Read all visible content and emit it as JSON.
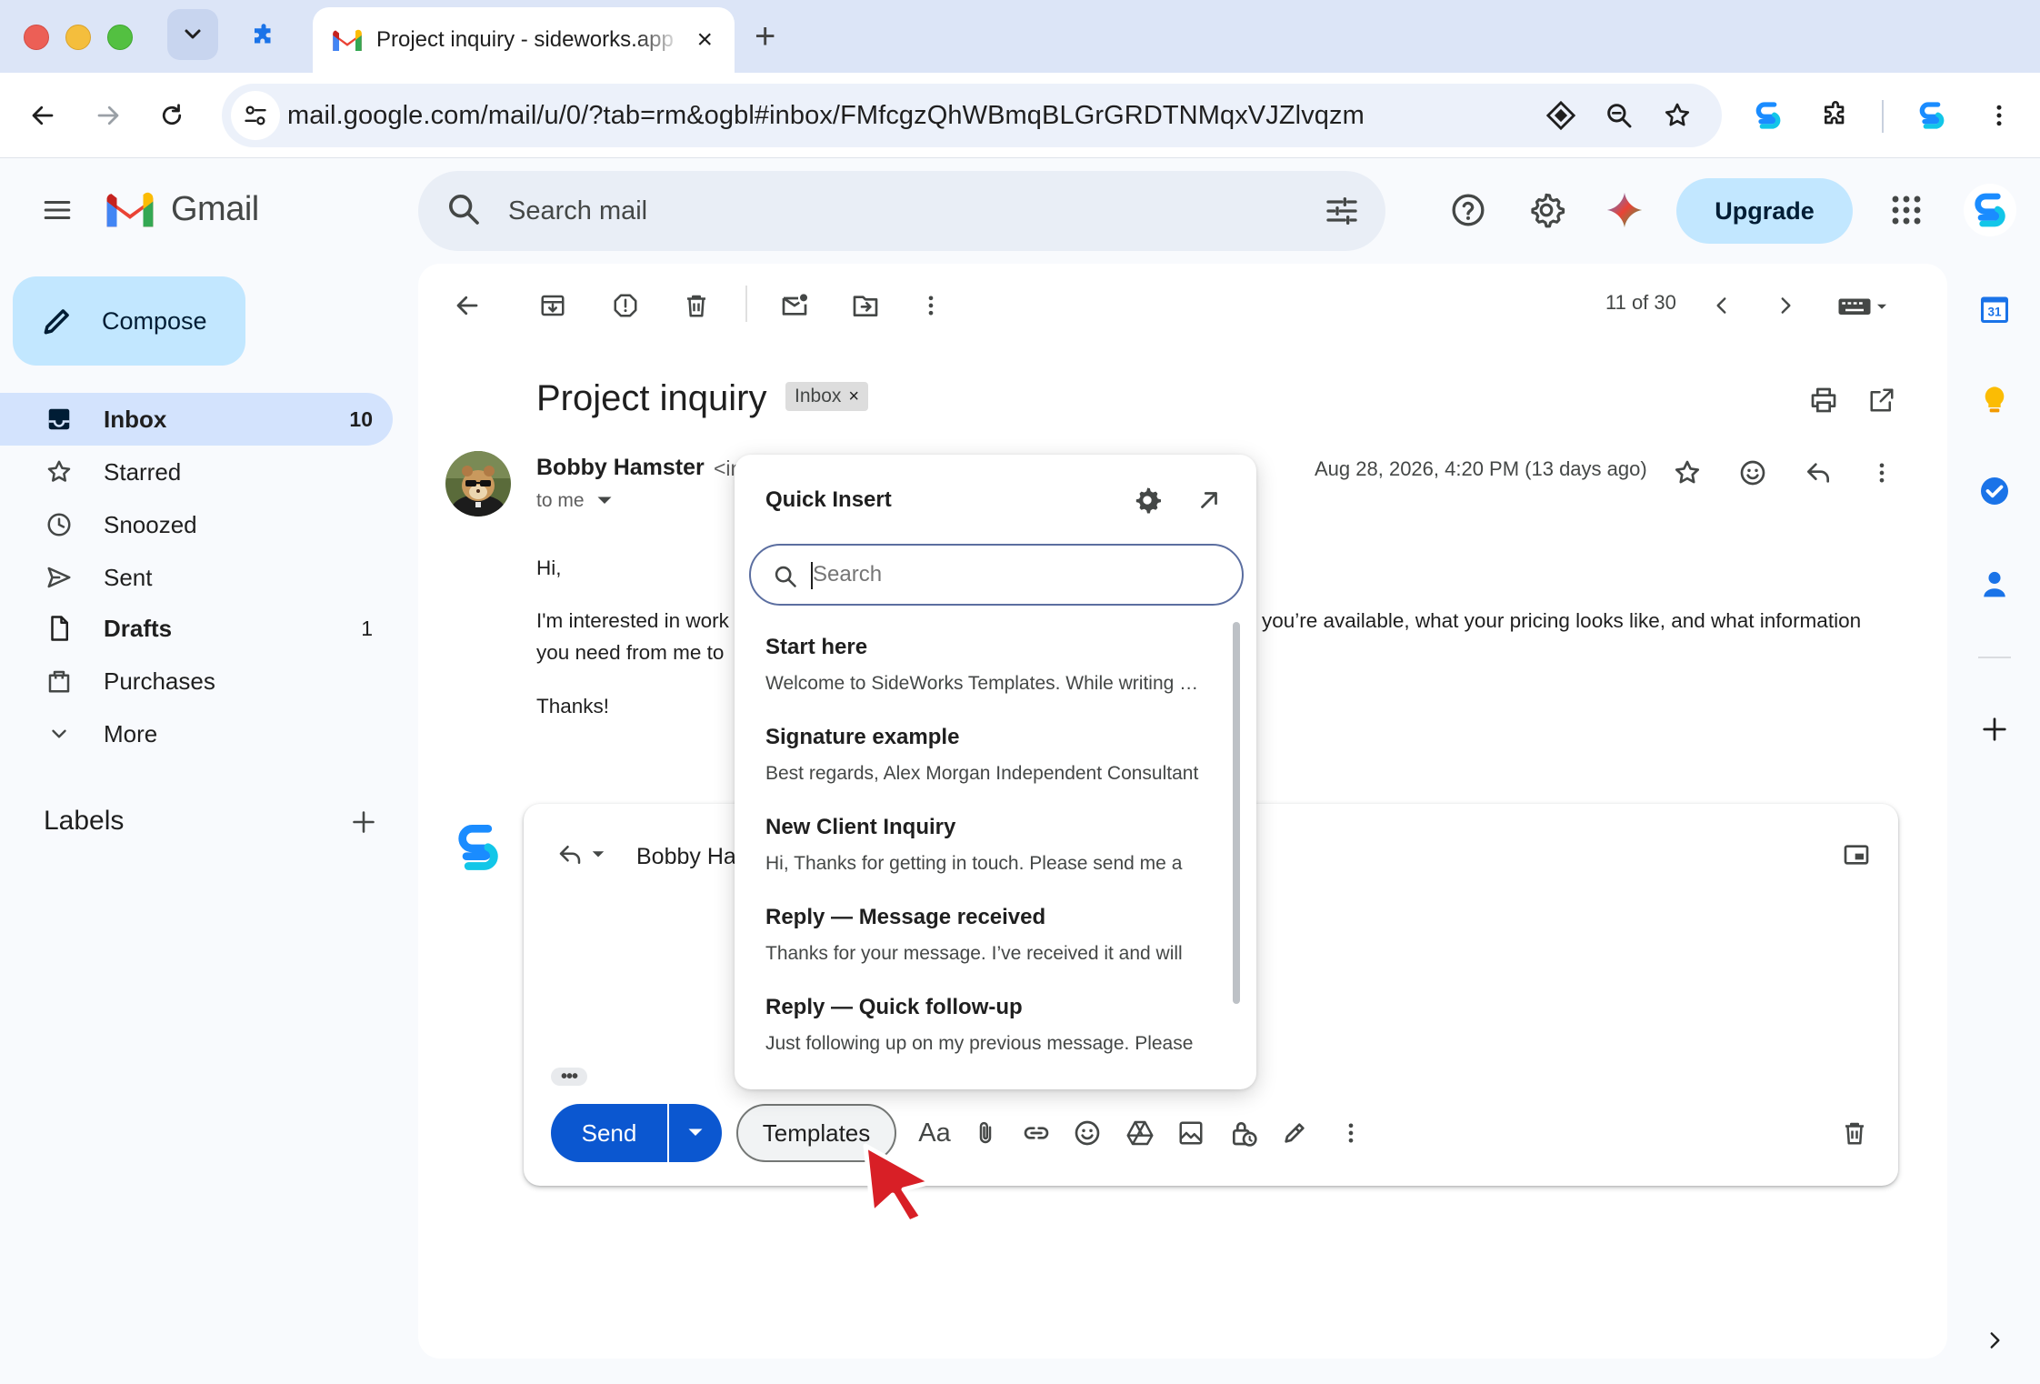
{
  "browser": {
    "tab_title": "Project inquiry - sideworks.app",
    "url": "mail.google.com/mail/u/0/?tab=rm&ogbl#inbox/FMfcgzQhWBmqBLGrGRDTNMqxVJZlvqzm"
  },
  "gmail": {
    "brand": "Gmail",
    "search_placeholder": "Search mail",
    "upgrade_label": "Upgrade",
    "compose_label": "Compose"
  },
  "sidebar": {
    "items": [
      {
        "label": "Inbox",
        "count": "10",
        "icon": "inbox-icon"
      },
      {
        "label": "Starred",
        "count": "",
        "icon": "star-icon"
      },
      {
        "label": "Snoozed",
        "count": "",
        "icon": "clock-icon"
      },
      {
        "label": "Sent",
        "count": "",
        "icon": "send-icon"
      },
      {
        "label": "Drafts",
        "count": "1",
        "icon": "draft-icon"
      },
      {
        "label": "Purchases",
        "count": "",
        "icon": "bag-icon"
      },
      {
        "label": "More",
        "count": "",
        "icon": "chevron-down-icon"
      }
    ],
    "labels_title": "Labels"
  },
  "message": {
    "page_count": "11 of 30",
    "subject": "Project inquiry",
    "label_chip": "Inbox",
    "sender_name": "Bobby Hamster",
    "sender_email_partial": "<in",
    "to": "to me",
    "date": "Aug 28, 2026, 4:20 PM (13 days ago)",
    "body": {
      "greeting": "Hi,",
      "line1_left": "I'm interested in work",
      "line1_right": "you’re available, what your pricing looks like, and what information",
      "line2": "you need from me to",
      "signoff": "Thanks!"
    }
  },
  "reply": {
    "to_partial": "Bobby Har",
    "send_label": "Send",
    "templates_label": "Templates",
    "format_label": "Aa"
  },
  "quick_insert": {
    "title": "Quick Insert",
    "search_placeholder": "Search",
    "items": [
      {
        "title": "Start here",
        "preview": "Welcome to SideWorks Templates. While writing an email"
      },
      {
        "title": "Signature example",
        "preview": "Best regards, Alex Morgan Independent Consultant"
      },
      {
        "title": "New Client Inquiry",
        "preview": "Hi, Thanks for getting in touch. Please send me a"
      },
      {
        "title": "Reply — Message received",
        "preview": "Thanks for your message. I’ve received it and will"
      },
      {
        "title": "Reply — Quick follow-up",
        "preview": "Just following up on my previous message. Please"
      }
    ]
  },
  "side_panel": {
    "calendar_day": "31"
  },
  "colors": {
    "accent": "#0b57d0",
    "compose_bg": "#c2e7ff",
    "active_nav": "#d3e3fd",
    "chrome_tabbar": "#dce5f7"
  }
}
